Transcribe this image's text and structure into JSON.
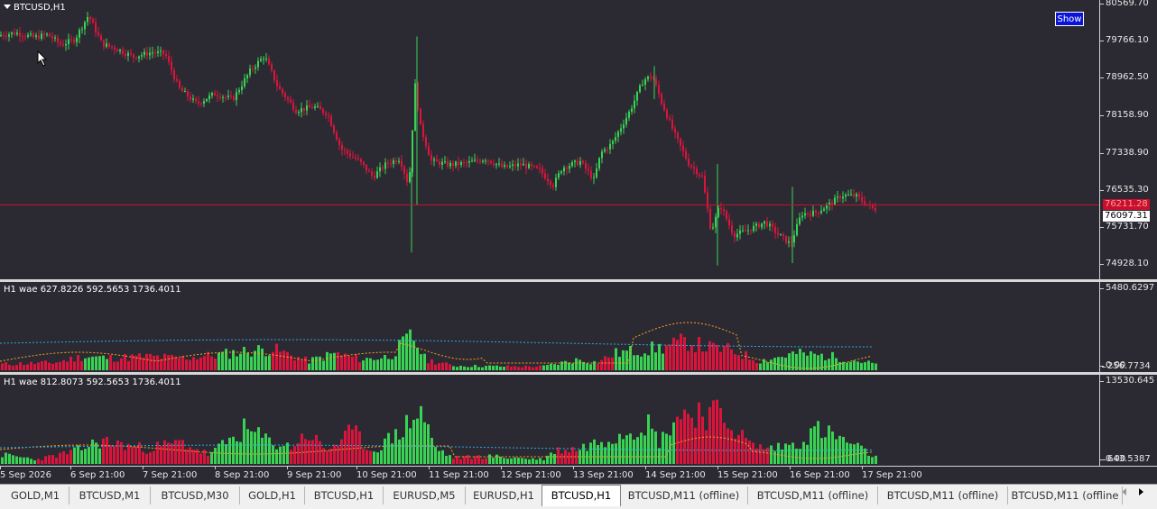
{
  "main": {
    "symbol_label": "BTCUSD,H1",
    "show_button": "Show",
    "price_labels": [
      "80569.70",
      "79766.10",
      "78962.50",
      "78158.90",
      "77338.90",
      "76535.30",
      "75731.70",
      "74928.10"
    ],
    "bid_tag": "76211.28",
    "last_price_tag": "76097.31",
    "hline_price": 76211.28,
    "y_range": [
      74600,
      80650
    ],
    "colors": {
      "up": "#39d353",
      "down": "#dc143c",
      "line": "#c8102e",
      "background": "#2b2a33"
    }
  },
  "indicator1": {
    "label": "H1 wae  627.8226 592.5653 1736.4011",
    "max_label": "5480.6297",
    "min_label": "0.00",
    "current_label": "256.7734"
  },
  "indicator2": {
    "label": "H1 wae  812.8073 592.5653 1736.4011",
    "max_label": "13530.645",
    "min_label": "0.00",
    "current_label": "643.5387"
  },
  "time_labels": [
    "5 Sep 2026",
    "6 Sep 21:00",
    "7 Sep 21:00",
    "8 Sep 21:00",
    "9 Sep 21:00",
    "10 Sep 21:00",
    "11 Sep 21:00",
    "12 Sep 21:00",
    "13 Sep 21:00",
    "14 Sep 21:00",
    "15 Sep 21:00",
    "16 Sep 21:00",
    "17 Sep 21:00"
  ],
  "tabs": [
    {
      "label": "GOLD,M1",
      "active": false
    },
    {
      "label": "BTCUSD,M1",
      "active": false
    },
    {
      "label": "BTCUSD,M30",
      "active": false
    },
    {
      "label": "GOLD,H1",
      "active": false
    },
    {
      "label": "BTCUSD,H1",
      "active": false
    },
    {
      "label": "EURUSD,M5",
      "active": false
    },
    {
      "label": "EURUSD,H1",
      "active": false
    },
    {
      "label": "BTCUSD,H1",
      "active": true
    },
    {
      "label": "BTCUSD,M11 (offline)",
      "active": false
    },
    {
      "label": "BTCUSD,M11 (offline)",
      "active": false
    },
    {
      "label": "BTCUSD,M11 (offline)",
      "active": false
    },
    {
      "label": "BTCUSD,M11 (offline",
      "active": false
    }
  ]
}
